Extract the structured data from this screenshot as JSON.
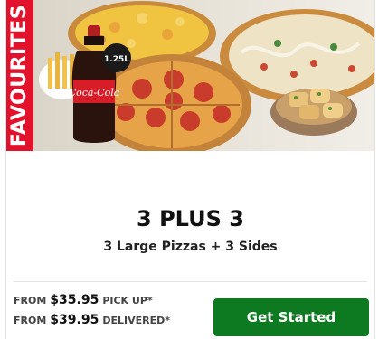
{
  "ribbon": {
    "label": "FAVOURITES"
  },
  "hero": {
    "bottle_size": "1.25L",
    "drink_label": "Coca-Cola"
  },
  "deal": {
    "title": "3 PLUS 3",
    "subtitle": "3 Large Pizzas + 3 Sides"
  },
  "pricing": [
    {
      "prefix": "FROM",
      "amount": "$35.95",
      "suffix": "PICK UP*"
    },
    {
      "prefix": "FROM",
      "amount": "$39.95",
      "suffix": "DELIVERED*"
    }
  ],
  "cta": {
    "label": "Get Started"
  },
  "colors": {
    "ribbon": "#e3122c",
    "cta": "#0d7a21"
  }
}
